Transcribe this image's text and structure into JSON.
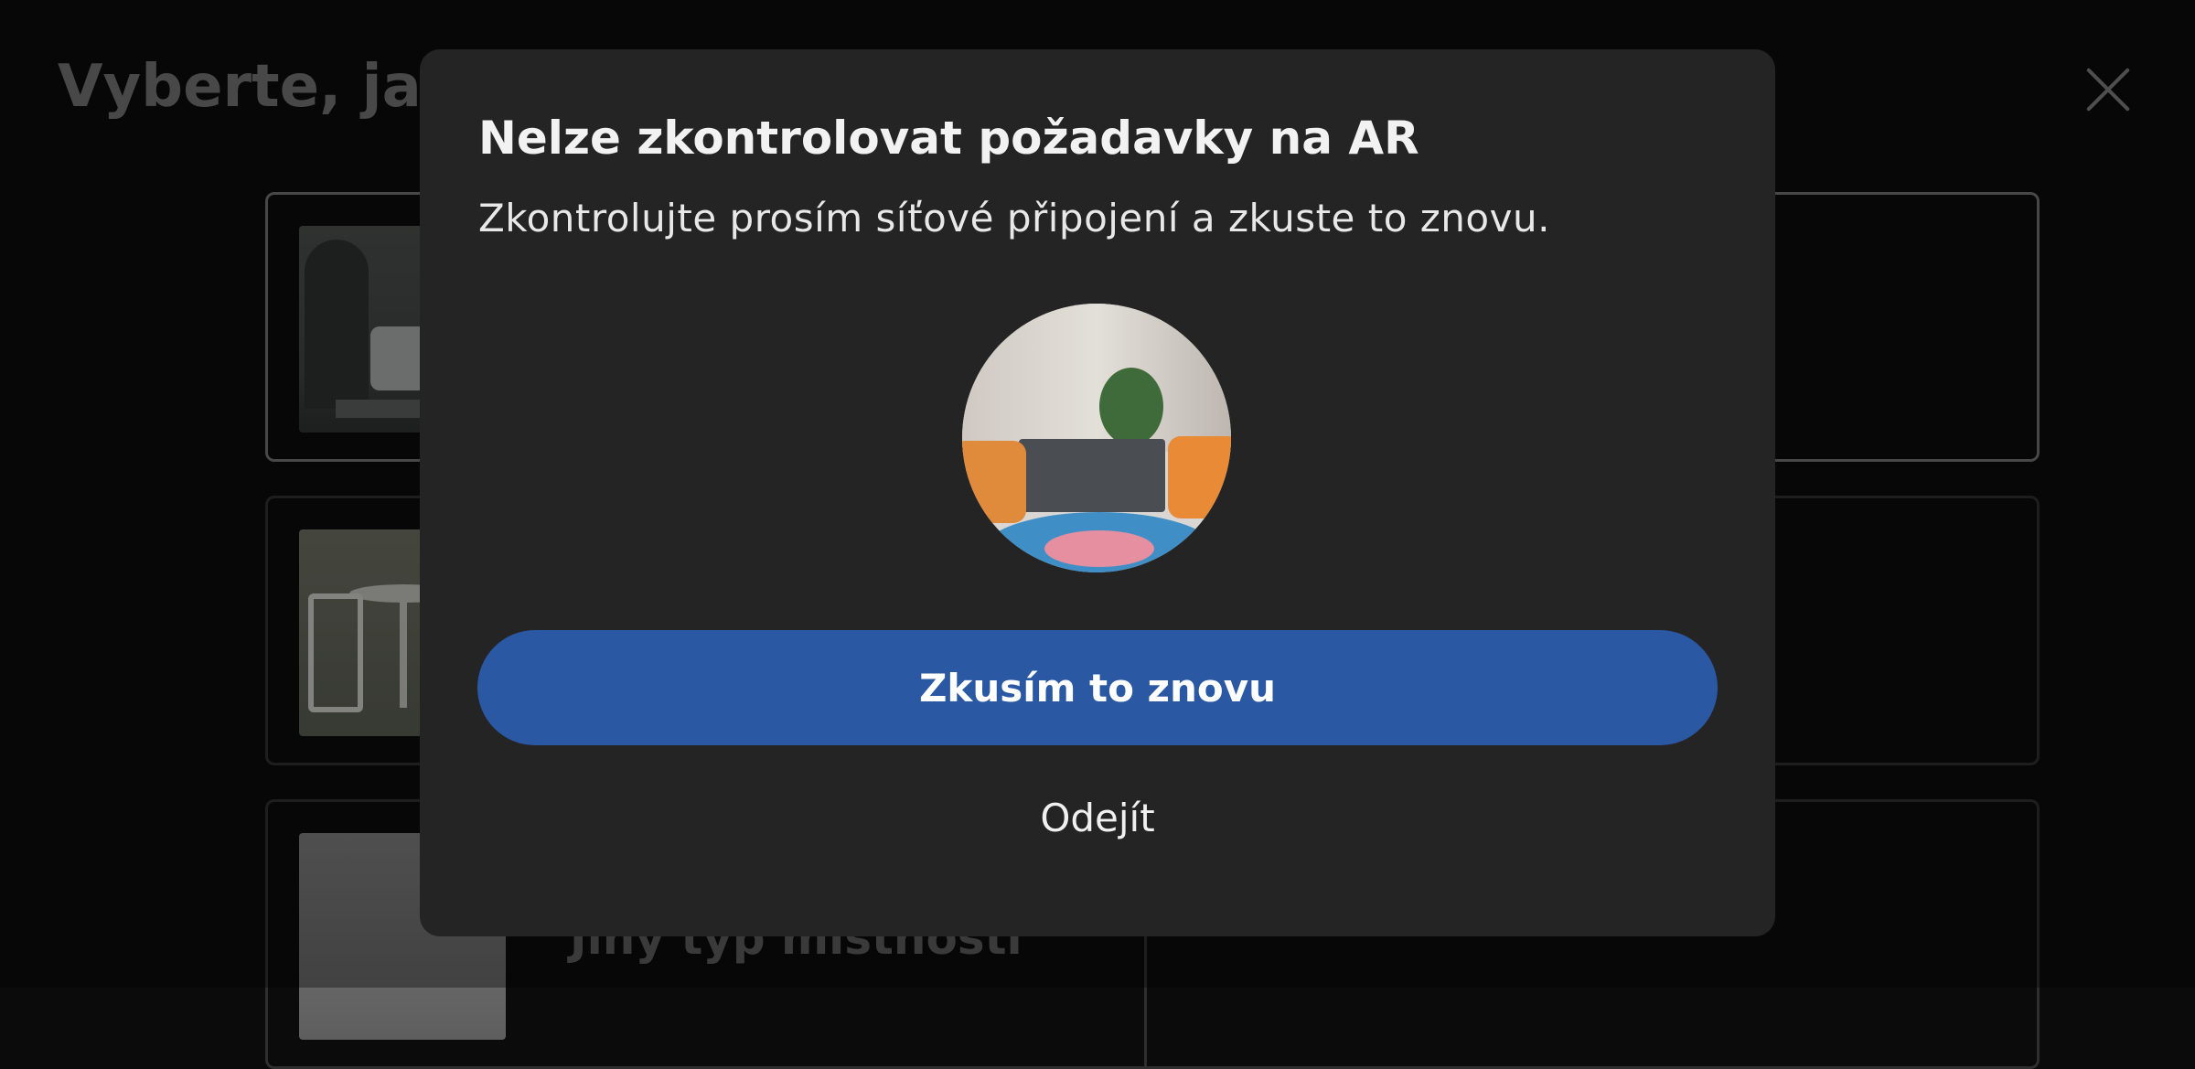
{
  "background": {
    "title": "Vyberte, jak",
    "cards": [
      {
        "label": ""
      },
      {
        "label": ""
      },
      {
        "label": "Jiný typ místnosti"
      }
    ]
  },
  "dialog": {
    "title": "Nelze zkontrolovat požadavky na AR",
    "message": "Zkontrolujte prosím síťové připojení a zkuste to znovu.",
    "primary_label": "Zkusím to znovu",
    "secondary_label": "Odejít"
  },
  "colors": {
    "primary": "#2a58a2",
    "dialog_bg": "#242425",
    "page_bg": "#0b0b0c"
  }
}
